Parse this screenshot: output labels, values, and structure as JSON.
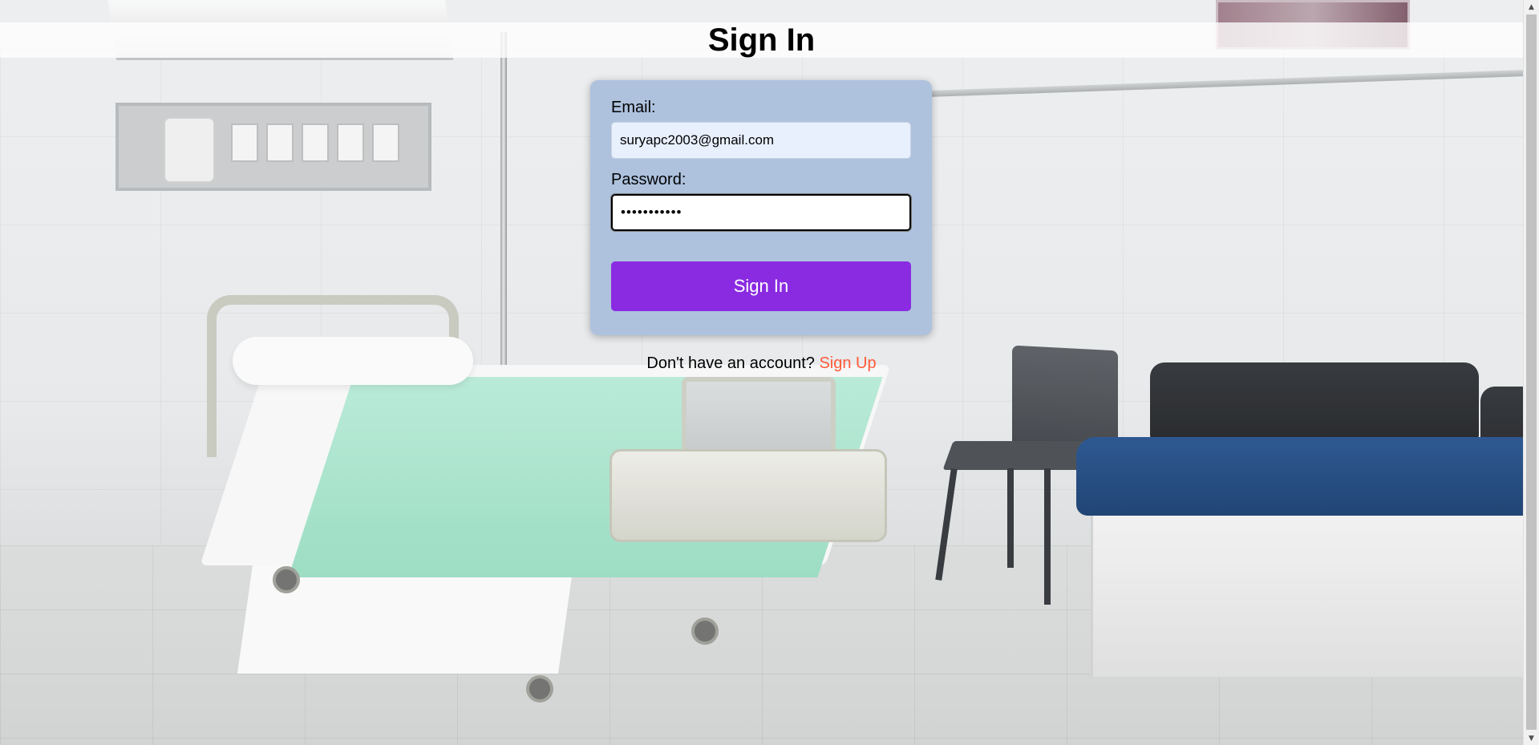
{
  "header": {
    "title": "Sign In"
  },
  "form": {
    "email_label": "Email:",
    "email_value": "suryapc2003@gmail.com",
    "password_label": "Password:",
    "password_value": "•••••••••••",
    "submit_label": "Sign In"
  },
  "footer": {
    "prompt_text": "Don't have an account?",
    "signup_link": "Sign Up"
  },
  "scrollbar": {
    "up_icon": "▲",
    "down_icon": "▼"
  },
  "colors": {
    "card_background": "#aec2de",
    "button_background": "#8a2be2",
    "link_color": "#ff5a36",
    "email_field_background": "#e8f0fe"
  }
}
